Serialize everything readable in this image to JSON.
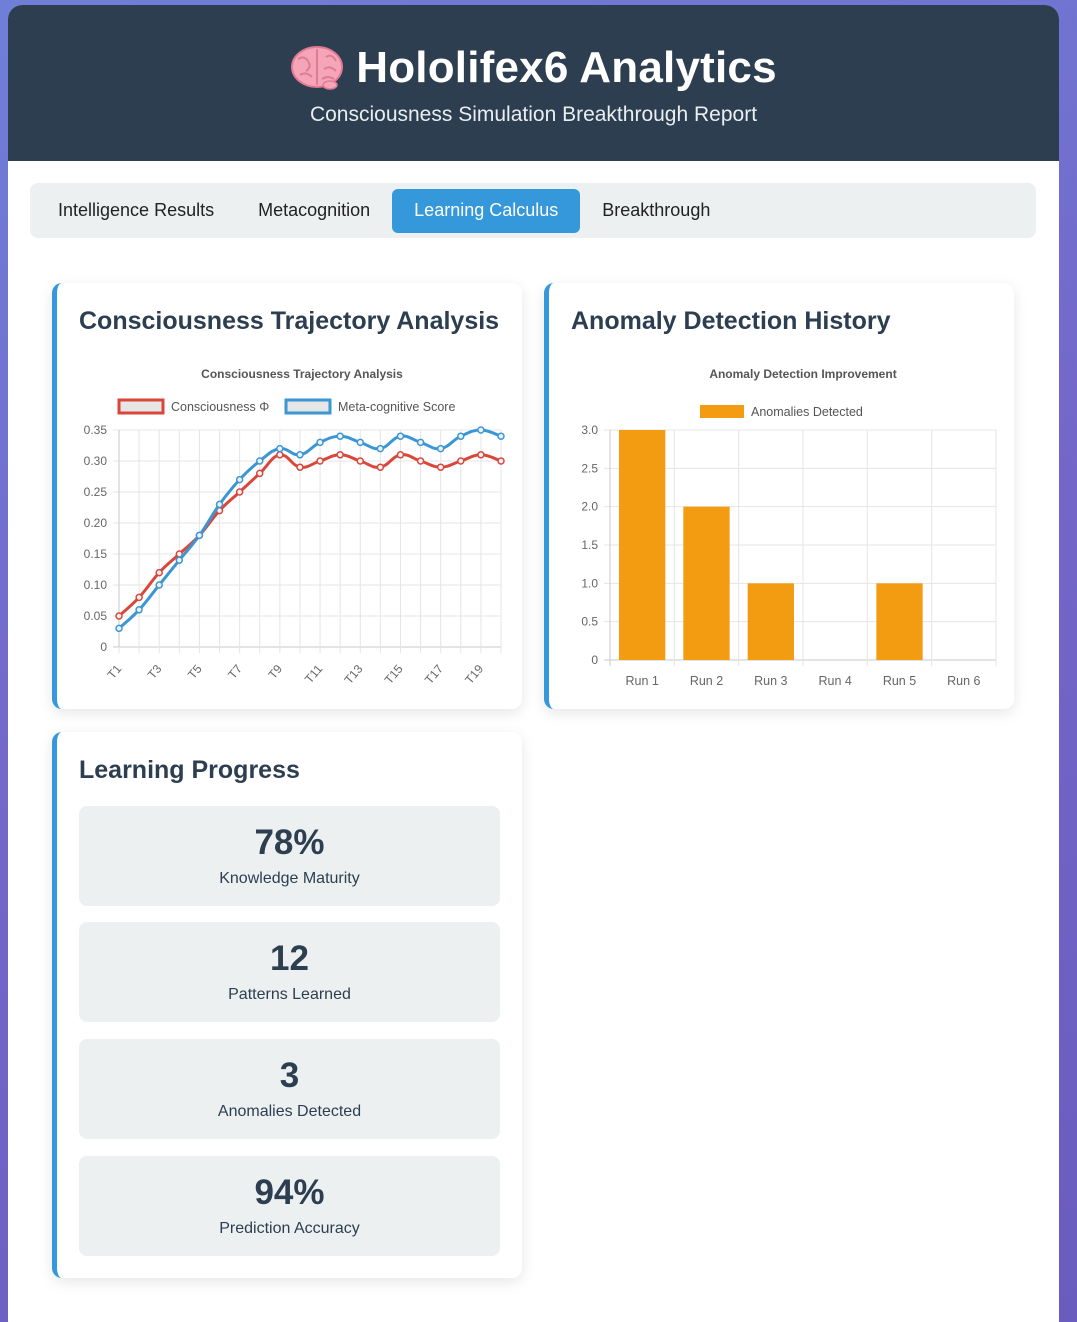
{
  "header": {
    "title": "Hololifex6 Analytics",
    "subtitle": "Consciousness Simulation Breakthrough Report",
    "icon": "brain-icon"
  },
  "tabs": [
    {
      "label": "Intelligence Results",
      "active": false
    },
    {
      "label": "Metacognition",
      "active": false
    },
    {
      "label": "Learning Calculus",
      "active": true
    },
    {
      "label": "Breakthrough",
      "active": false
    }
  ],
  "cards": {
    "trajectory_title": "Consciousness Trajectory Analysis",
    "anomaly_title": "Anomaly Detection History",
    "learning_title": "Learning Progress"
  },
  "stats": [
    {
      "value": "78%",
      "label": "Knowledge Maturity"
    },
    {
      "value": "12",
      "label": "Patterns Learned"
    },
    {
      "value": "3",
      "label": "Anomalies Detected"
    },
    {
      "value": "94%",
      "label": "Prediction Accuracy"
    }
  ],
  "colors": {
    "header_bg": "#2c3e50",
    "accent": "#3498db",
    "series_consciousness": "#d9473b",
    "series_meta": "#3a97d4",
    "bar": "#f39c12"
  },
  "chart_data": [
    {
      "type": "line",
      "title": "Consciousness Trajectory Analysis",
      "x": [
        "T1",
        "T2",
        "T3",
        "T4",
        "T5",
        "T6",
        "T7",
        "T8",
        "T9",
        "T10",
        "T11",
        "T12",
        "T13",
        "T14",
        "T15",
        "T16",
        "T17",
        "T18",
        "T19",
        "T20"
      ],
      "x_tick_labels": [
        "T1",
        "T3",
        "T5",
        "T7",
        "T9",
        "T11",
        "T13",
        "T15",
        "T17",
        "T19"
      ],
      "series": [
        {
          "name": "Consciousness Φ",
          "values": [
            0.05,
            0.08,
            0.12,
            0.15,
            0.18,
            0.22,
            0.25,
            0.28,
            0.31,
            0.29,
            0.3,
            0.31,
            0.3,
            0.29,
            0.31,
            0.3,
            0.29,
            0.3,
            0.31,
            0.3
          ]
        },
        {
          "name": "Meta-cognitive Score",
          "values": [
            0.03,
            0.06,
            0.1,
            0.14,
            0.18,
            0.23,
            0.27,
            0.3,
            0.32,
            0.31,
            0.33,
            0.34,
            0.33,
            0.32,
            0.34,
            0.33,
            0.32,
            0.34,
            0.35,
            0.34
          ]
        }
      ],
      "ylim": [
        0,
        0.35
      ],
      "y_ticks": [
        "0",
        "0.05",
        "0.10",
        "0.15",
        "0.20",
        "0.25",
        "0.30",
        "0.35"
      ],
      "grid": true,
      "legend": "top"
    },
    {
      "type": "bar",
      "title": "Anomaly Detection Improvement",
      "categories": [
        "Run 1",
        "Run 2",
        "Run 3",
        "Run 4",
        "Run 5",
        "Run 6"
      ],
      "series": [
        {
          "name": "Anomalies Detected",
          "values": [
            3,
            2,
            1,
            0,
            1,
            0
          ]
        }
      ],
      "ylim": [
        0,
        3
      ],
      "y_ticks": [
        "0",
        "0.5",
        "1.0",
        "1.5",
        "2.0",
        "2.5",
        "3.0"
      ],
      "grid": true,
      "legend": "top"
    }
  ]
}
